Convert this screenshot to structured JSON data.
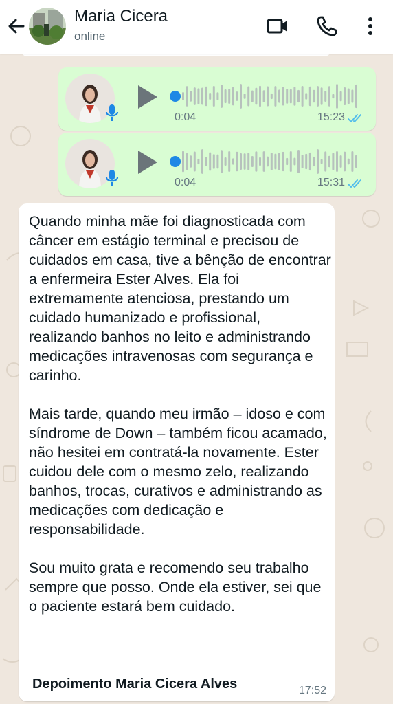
{
  "header": {
    "contact_name": "Maria Cicera",
    "status": "online",
    "icons": {
      "back": "arrow-left-icon",
      "video": "video-camera-icon",
      "call": "phone-icon",
      "menu": "more-vertical-icon"
    }
  },
  "voice_messages": [
    {
      "duration": "0:04",
      "time": "15:23",
      "status": "read"
    },
    {
      "duration": "0:04",
      "time": "15:31",
      "status": "read"
    }
  ],
  "text_message": {
    "paragraphs": [
      "Quando minha mãe foi diagnosticada com câncer em estágio terminal e precisou de cuidados em casa, tive a bênção de encontrar a enfermeira Ester Alves. Ela foi extremamente atenciosa, prestando um cuidado humanizado e profissional, realizando banhos no leito e administrando medicações intravenosas com segurança e carinho.",
      "Mais tarde, quando meu irmão – idoso e com síndrome de Down – também ficou acamado, não hesitei em contratá-la novamente. Ester cuidou dele com o mesmo zelo, realizando banhos, trocas, curativos e administrando as medicações com dedicação e responsabilidade.",
      "Sou muito grata e recomendo seu trabalho sempre que posso. Onde ela estiver, sei que o paciente estará bem cuidado."
    ],
    "signature": "Depoimento Maria Cicera Alves",
    "time": "17:52"
  },
  "colors": {
    "chat_background": "#efe7de",
    "outgoing_bubble": "#d9fdd3",
    "incoming_bubble": "#ffffff",
    "read_ticks": "#53bdeb",
    "playback_dot": "#1e88e5",
    "mic_badge": "#1e88e5"
  }
}
